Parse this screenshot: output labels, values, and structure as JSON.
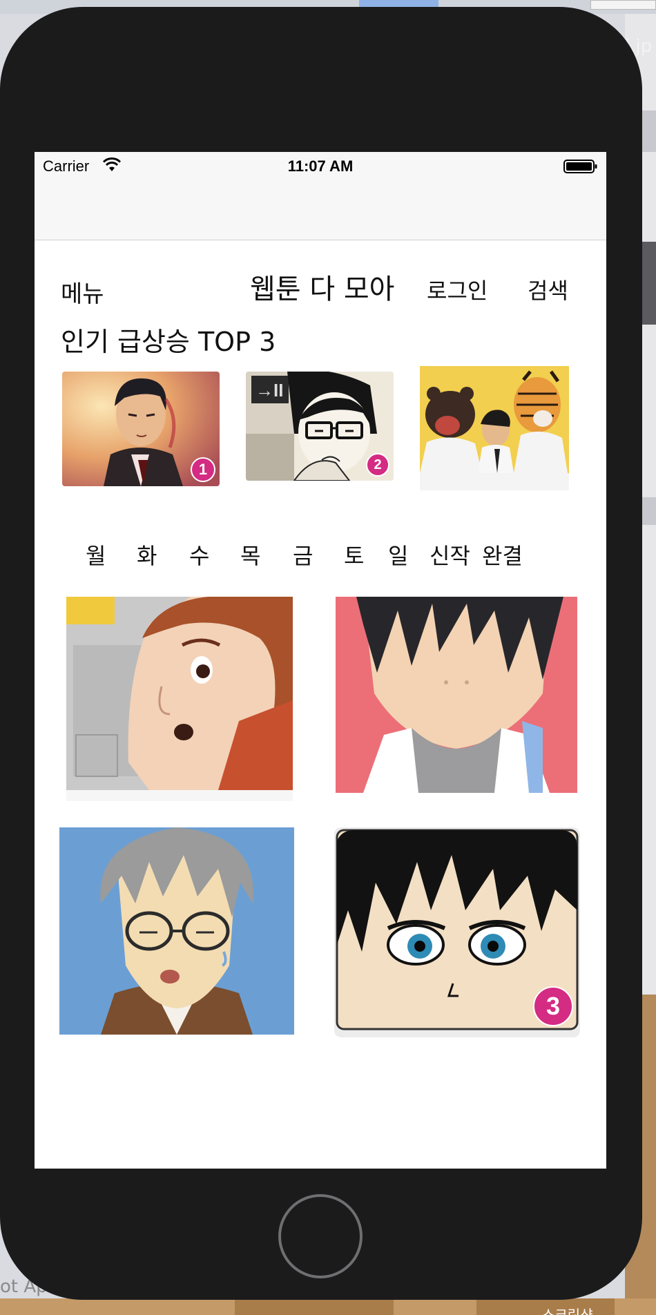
{
  "status_bar": {
    "carrier": "Carrier",
    "time": "11:07 AM"
  },
  "nav": {
    "menu": "메뉴",
    "title": "웹툰 다 모아",
    "login": "로그인",
    "search": "검색"
  },
  "top3": {
    "title": "인기 급상승 TOP 3",
    "items": [
      {
        "rank": "1",
        "icon": "manga-cover-businessman"
      },
      {
        "rank": "2",
        "icon": "manga-cover-glasses-boy"
      },
      {
        "rank": "",
        "icon": "manga-cover-bear-tiger"
      }
    ]
  },
  "day_tabs": [
    "월",
    "화",
    "수",
    "목",
    "금",
    "토",
    "일",
    "신작",
    "완결"
  ],
  "webtoon_grid": {
    "items": [
      {
        "icon": "manga-cover-surprised-boy",
        "rank": ""
      },
      {
        "icon": "manga-cover-dark-hair",
        "rank": ""
      },
      {
        "icon": "manga-cover-glasses-grey-hair",
        "rank": ""
      },
      {
        "icon": "manga-cover-blue-eyes",
        "rank": "3"
      }
    ]
  },
  "desktop": {
    "snippet_right": "l.jp",
    "snippet_bottom_left": "ot Ap",
    "snippet_bottom_right": "스크린샷"
  }
}
